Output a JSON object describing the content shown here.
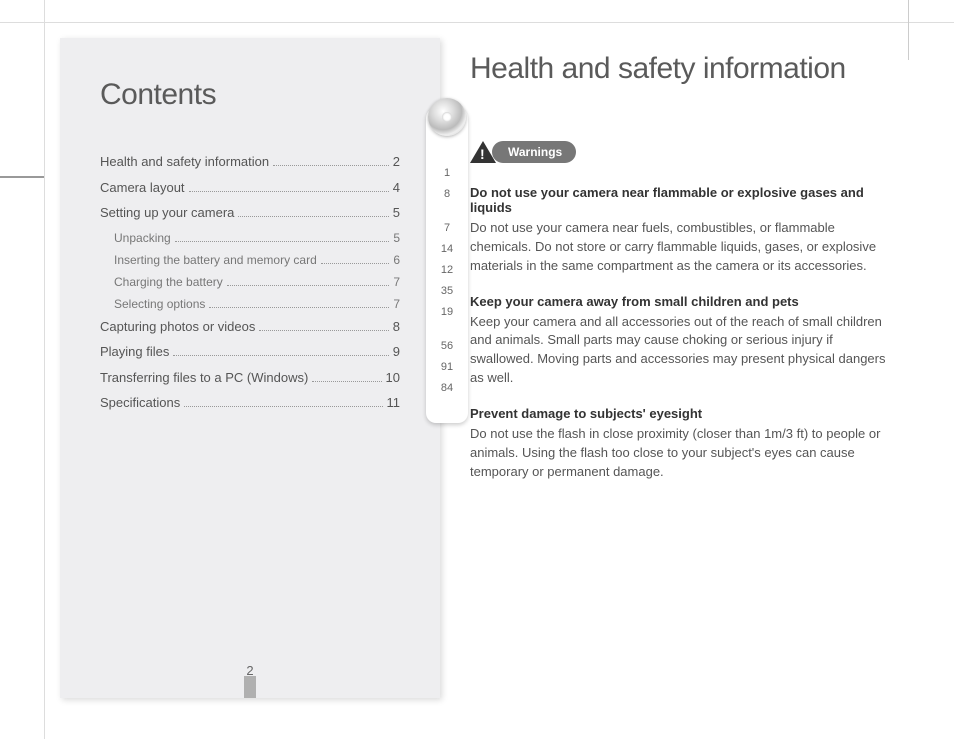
{
  "left": {
    "title": "Contents",
    "toc": [
      {
        "label": "Health and safety information",
        "page": "2",
        "sub": false
      },
      {
        "label": "Camera layout",
        "page": "4",
        "sub": false
      },
      {
        "label": "Setting up your camera",
        "page": "5",
        "sub": false
      },
      {
        "label": "Unpacking",
        "page": "5",
        "sub": true
      },
      {
        "label": "Inserting the battery and memory card",
        "page": "6",
        "sub": true
      },
      {
        "label": "Charging the battery",
        "page": "7",
        "sub": true
      },
      {
        "label": "Selecting options",
        "page": "7",
        "sub": true
      },
      {
        "label": "Capturing photos or videos",
        "page": "8",
        "sub": false
      },
      {
        "label": "Playing files",
        "page": "9",
        "sub": false
      },
      {
        "label": "Transferring files to a PC (Windows)",
        "page": "10",
        "sub": false
      },
      {
        "label": "Specifications",
        "page": "11",
        "sub": false
      }
    ],
    "side_numbers": [
      "1",
      "8",
      "7",
      "14",
      "12",
      "35",
      "19",
      "56",
      "91",
      "84"
    ],
    "page_number": "2"
  },
  "right": {
    "title": "Health and safety information",
    "warning_label": "Warnings",
    "sections": [
      {
        "heading": "Do not use your camera near flammable or explosive gases and liquids",
        "body": "Do not use your camera near fuels, combustibles, or flammable chemicals. Do not store or carry flammable liquids, gases, or explosive materials in the same compartment as the camera or its accessories."
      },
      {
        "heading": "Keep your camera away from small children and pets",
        "body": "Keep your camera and all accessories out of the reach of small children and animals. Small parts may cause choking or serious injury if swallowed. Moving parts and accessories may present physical dangers as well."
      },
      {
        "heading": "Prevent damage to subjects' eyesight",
        "body": "Do not use the flash in close proximity (closer than 1m/3 ft) to people or animals. Using the flash too close to your subject's eyes can cause temporary or permanent damage."
      }
    ]
  }
}
